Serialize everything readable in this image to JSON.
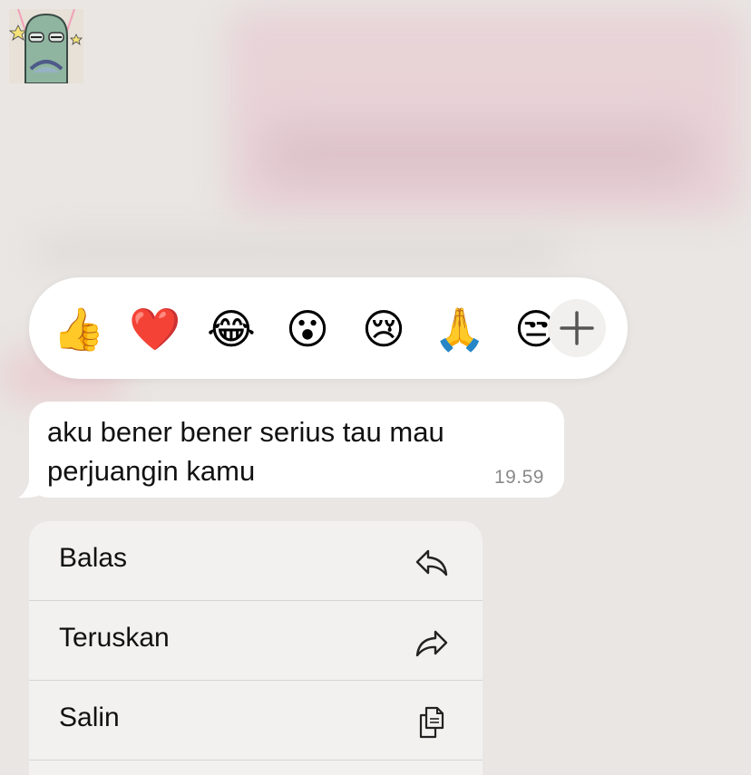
{
  "reactions": [
    {
      "name": "thumbs-up",
      "glyph": "👍"
    },
    {
      "name": "red-heart",
      "glyph": "❤️"
    },
    {
      "name": "tears-of-joy",
      "glyph": "😂"
    },
    {
      "name": "surprised-face",
      "glyph": "😮"
    },
    {
      "name": "crying-face",
      "glyph": "😢"
    },
    {
      "name": "folded-hands",
      "glyph": "🙏"
    },
    {
      "name": "partial-face",
      "glyph": "😒"
    }
  ],
  "reaction_more_label": "+",
  "message": {
    "text": "aku bener bener serius tau mau perjuangin kamu",
    "time": "19.59"
  },
  "menu": {
    "items": [
      {
        "label": "Balas",
        "icon": "reply-icon"
      },
      {
        "label": "Teruskan",
        "icon": "forward-icon"
      },
      {
        "label": "Salin",
        "icon": "copy-icon"
      }
    ]
  },
  "colors": {
    "background": "#e9e6e3",
    "bubble": "#ffffff",
    "menu": "#f2f1f0",
    "timestamp": "#8a8a8a"
  }
}
